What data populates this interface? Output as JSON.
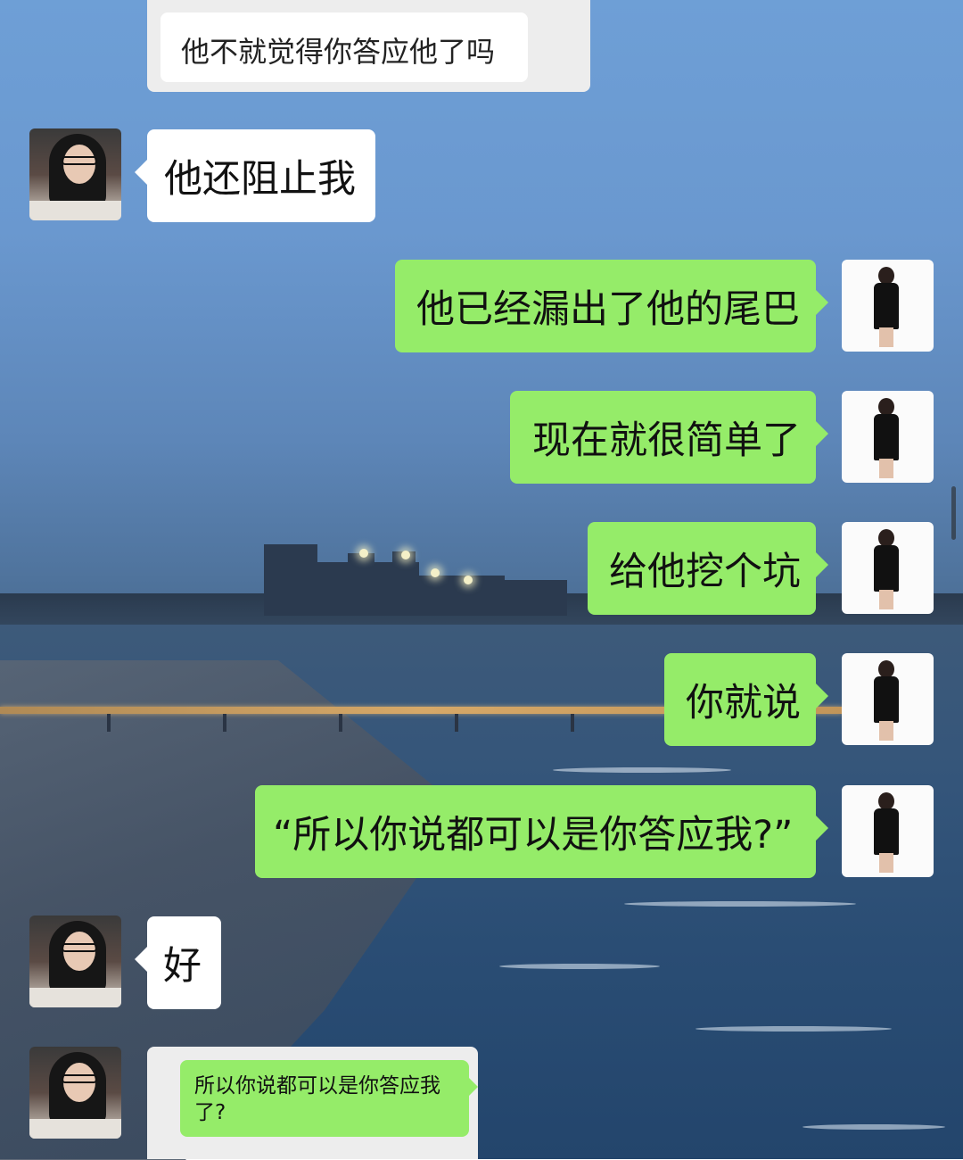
{
  "quoted_message": {
    "text": "他不就觉得你答应他了吗"
  },
  "messages": [
    {
      "side": "left",
      "text": "他还阻止我"
    },
    {
      "side": "right",
      "text": "他已经漏出了他的尾巴"
    },
    {
      "side": "right",
      "text": "现在就很简单了"
    },
    {
      "side": "right",
      "text": "给他挖个坑"
    },
    {
      "side": "right",
      "text": "你就说"
    },
    {
      "side": "right",
      "text": "“所以你说都可以是你答应我?”"
    },
    {
      "side": "left",
      "text": "好"
    }
  ],
  "quoted_reply": {
    "text": "所以你说都可以是你答应我了?"
  },
  "colors": {
    "bubble_green": "#95ec69",
    "bubble_white": "#ffffff",
    "quote_card": "#ededed"
  }
}
